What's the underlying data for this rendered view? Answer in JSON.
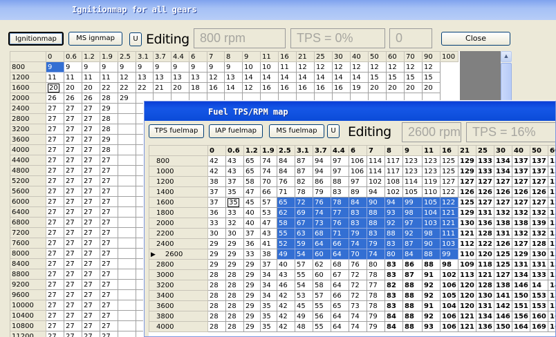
{
  "w1": {
    "title": "Ignitionmap for all gears",
    "btn_ign": "Ignitionmap",
    "btn_ms": "MS ignmap",
    "btn_u": "U",
    "editing": "Editing",
    "rpm": "800 rpm",
    "tps": "TPS =  0%",
    "val": "0",
    "close": "Close",
    "cols": [
      "0",
      "0.6",
      "1.2",
      "1.9",
      "2.5",
      "3.1",
      "3.7",
      "4.4",
      "6",
      "7",
      "8",
      "9",
      "11",
      "16",
      "21",
      "25",
      "30",
      "40",
      "50",
      "60",
      "70",
      "90",
      "100"
    ],
    "rows": [
      [
        "800",
        [
          "9",
          "9",
          "9",
          "9",
          "9",
          "9",
          "9",
          "9",
          "9",
          "9",
          "9",
          "10",
          "10",
          "11",
          "12",
          "12",
          "12",
          "12",
          "12",
          "12",
          "12",
          "12"
        ]
      ],
      [
        "1200",
        [
          "11",
          "11",
          "11",
          "11",
          "12",
          "13",
          "13",
          "13",
          "13",
          "12",
          "13",
          "14",
          "14",
          "14",
          "14",
          "14",
          "14",
          "14",
          "15",
          "15",
          "15",
          "15"
        ]
      ],
      [
        "1600",
        [
          "20",
          "20",
          "20",
          "22",
          "22",
          "22",
          "21",
          "20",
          "18",
          "16",
          "14",
          "12",
          "16",
          "16",
          "16",
          "16",
          "16",
          "19",
          "20",
          "20",
          "20",
          "20"
        ]
      ],
      [
        "2000",
        [
          "26",
          "26",
          "26",
          "28",
          "29",
          "",
          "",
          "",
          "",
          "",
          "",
          "",
          "",
          "",
          "",
          "",
          "",
          "",
          "",
          "",
          "",
          ""
        ]
      ],
      [
        "2400",
        [
          "27",
          "27",
          "27",
          "29",
          "",
          "",
          "",
          "",
          "",
          "",
          "",
          "",
          "",
          "",
          "",
          "",
          "",
          "",
          "",
          "",
          "",
          ""
        ]
      ],
      [
        "2800",
        [
          "27",
          "27",
          "27",
          "28",
          "",
          "",
          "",
          "",
          "",
          "",
          "",
          "",
          "",
          "",
          "",
          "",
          "",
          "",
          "",
          "",
          "",
          ""
        ]
      ],
      [
        "3200",
        [
          "27",
          "27",
          "27",
          "28",
          "",
          "",
          "",
          "",
          "",
          "",
          "",
          "",
          "",
          "",
          "",
          "",
          "",
          "",
          "",
          "",
          "",
          ""
        ]
      ],
      [
        "3600",
        [
          "27",
          "27",
          "27",
          "29",
          "",
          "",
          "",
          "",
          "",
          "",
          "",
          "",
          "",
          "",
          "",
          "",
          "",
          "",
          "",
          "",
          "",
          ""
        ]
      ],
      [
        "4000",
        [
          "27",
          "27",
          "27",
          "28",
          "",
          "",
          "",
          "",
          "",
          "",
          "",
          "",
          "",
          "",
          "",
          "",
          "",
          "",
          "",
          "",
          "",
          ""
        ]
      ],
      [
        "4400",
        [
          "27",
          "27",
          "27",
          "27",
          "",
          "",
          "",
          "",
          "",
          "",
          "",
          "",
          "",
          "",
          "",
          "",
          "",
          "",
          "",
          "",
          "",
          ""
        ]
      ],
      [
        "4800",
        [
          "27",
          "27",
          "27",
          "27",
          "",
          "",
          "",
          "",
          "",
          "",
          "",
          "",
          "",
          "",
          "",
          "",
          "",
          "",
          "",
          "",
          "",
          ""
        ]
      ],
      [
        "5200",
        [
          "27",
          "27",
          "27",
          "27",
          "",
          "",
          "",
          "",
          "",
          "",
          "",
          "",
          "",
          "",
          "",
          "",
          "",
          "",
          "",
          "",
          "",
          ""
        ]
      ],
      [
        "5600",
        [
          "27",
          "27",
          "27",
          "27",
          "",
          "",
          "",
          "",
          "",
          "",
          "",
          "",
          "",
          "",
          "",
          "",
          "",
          "",
          "",
          "",
          "",
          ""
        ]
      ],
      [
        "6000",
        [
          "27",
          "27",
          "27",
          "27",
          "",
          "",
          "",
          "",
          "",
          "",
          "",
          "",
          "",
          "",
          "",
          "",
          "",
          "",
          "",
          "",
          "",
          ""
        ]
      ],
      [
        "6400",
        [
          "27",
          "27",
          "27",
          "27",
          "",
          "",
          "",
          "",
          "",
          "",
          "",
          "",
          "",
          "",
          "",
          "",
          "",
          "",
          "",
          "",
          "",
          ""
        ]
      ],
      [
        "6800",
        [
          "27",
          "27",
          "27",
          "27",
          "",
          "",
          "",
          "",
          "",
          "",
          "",
          "",
          "",
          "",
          "",
          "",
          "",
          "",
          "",
          "",
          "",
          ""
        ]
      ],
      [
        "7200",
        [
          "27",
          "27",
          "27",
          "27",
          "",
          "",
          "",
          "",
          "",
          "",
          "",
          "",
          "",
          "",
          "",
          "",
          "",
          "",
          "",
          "",
          "",
          ""
        ]
      ],
      [
        "7600",
        [
          "27",
          "27",
          "27",
          "27",
          "",
          "",
          "",
          "",
          "",
          "",
          "",
          "",
          "",
          "",
          "",
          "",
          "",
          "",
          "",
          "",
          "",
          ""
        ]
      ],
      [
        "8000",
        [
          "27",
          "27",
          "27",
          "27",
          "",
          "",
          "",
          "",
          "",
          "",
          "",
          "",
          "",
          "",
          "",
          "",
          "",
          "",
          "",
          "",
          "",
          ""
        ]
      ],
      [
        "8400",
        [
          "27",
          "27",
          "27",
          "27",
          "",
          "",
          "",
          "",
          "",
          "",
          "",
          "",
          "",
          "",
          "",
          "",
          "",
          "",
          "",
          "",
          "",
          ""
        ]
      ],
      [
        "8800",
        [
          "27",
          "27",
          "27",
          "27",
          "",
          "",
          "",
          "",
          "",
          "",
          "",
          "",
          "",
          "",
          "",
          "",
          "",
          "",
          "",
          "",
          "",
          ""
        ]
      ],
      [
        "9200",
        [
          "27",
          "27",
          "27",
          "27",
          "",
          "",
          "",
          "",
          "",
          "",
          "",
          "",
          "",
          "",
          "",
          "",
          "",
          "",
          "",
          "",
          "",
          ""
        ]
      ],
      [
        "9600",
        [
          "27",
          "27",
          "27",
          "27",
          "",
          "",
          "",
          "",
          "",
          "",
          "",
          "",
          "",
          "",
          "",
          "",
          "",
          "",
          "",
          "",
          "",
          ""
        ]
      ],
      [
        "10000",
        [
          "27",
          "27",
          "27",
          "27",
          "",
          "",
          "",
          "",
          "",
          "",
          "",
          "",
          "",
          "",
          "",
          "",
          "",
          "",
          "",
          "",
          "",
          ""
        ]
      ],
      [
        "10400",
        [
          "27",
          "27",
          "27",
          "27",
          "",
          "",
          "",
          "",
          "",
          "",
          "",
          "",
          "",
          "",
          "",
          "",
          "",
          "",
          "",
          "",
          "",
          ""
        ]
      ],
      [
        "10800",
        [
          "27",
          "27",
          "27",
          "27",
          "",
          "",
          "",
          "",
          "",
          "",
          "",
          "",
          "",
          "",
          "",
          "",
          "",
          "",
          "",
          "",
          "",
          ""
        ]
      ],
      [
        "11200",
        [
          "27",
          "27",
          "27",
          "27",
          "",
          "",
          "",
          "",
          "",
          "",
          "",
          "",
          "",
          "",
          "",
          "",
          "",
          "",
          "",
          "",
          "",
          ""
        ]
      ]
    ]
  },
  "w2": {
    "title": "Fuel TPS/RPM map",
    "btn_tps": "TPS fuelmap",
    "btn_iap": "IAP fuelmap",
    "btn_ms": "MS fuelmap",
    "btn_u": "U",
    "editing": "Editing",
    "rpm": "2600 rpm",
    "tps": "TPS =  16%",
    "marker": "▶",
    "cols": [
      "0",
      "0.6",
      "1.2",
      "1.9",
      "2.5",
      "3.1",
      "3.7",
      "4.4",
      "6",
      "7",
      "8",
      "9",
      "11",
      "16",
      "21",
      "25",
      "30",
      "40",
      "50",
      "60"
    ],
    "rows": [
      [
        "800",
        [
          "42",
          "43",
          "65",
          "74",
          "84",
          "87",
          "94",
          "97",
          "106",
          "114",
          "117",
          "123",
          "123",
          "125",
          "129",
          "133",
          "134",
          "137",
          "137",
          "13"
        ]
      ],
      [
        "1000",
        [
          "42",
          "43",
          "65",
          "74",
          "84",
          "87",
          "94",
          "97",
          "106",
          "114",
          "117",
          "123",
          "123",
          "125",
          "129",
          "133",
          "134",
          "137",
          "137",
          "13"
        ]
      ],
      [
        "1200",
        [
          "38",
          "37",
          "58",
          "70",
          "76",
          "82",
          "86",
          "88",
          "97",
          "102",
          "108",
          "114",
          "119",
          "127",
          "127",
          "127",
          "127",
          "127",
          "127",
          "12"
        ]
      ],
      [
        "1400",
        [
          "37",
          "35",
          "47",
          "66",
          "71",
          "78",
          "79",
          "83",
          "89",
          "94",
          "102",
          "105",
          "110",
          "122",
          "126",
          "126",
          "126",
          "126",
          "126",
          "12"
        ]
      ],
      [
        "1600",
        [
          "37",
          "35",
          "45",
          "57",
          "65",
          "72",
          "76",
          "78",
          "84",
          "90",
          "94",
          "99",
          "105",
          "122",
          "125",
          "127",
          "127",
          "127",
          "127",
          "12"
        ]
      ],
      [
        "1800",
        [
          "36",
          "33",
          "40",
          "53",
          "62",
          "69",
          "74",
          "77",
          "83",
          "88",
          "93",
          "98",
          "104",
          "121",
          "129",
          "131",
          "132",
          "132",
          "132",
          "13"
        ]
      ],
      [
        "2000",
        [
          "33",
          "32",
          "40",
          "47",
          "58",
          "67",
          "73",
          "76",
          "83",
          "88",
          "92",
          "97",
          "103",
          "121",
          "130",
          "136",
          "138",
          "138",
          "139",
          "13"
        ]
      ],
      [
        "2200",
        [
          "30",
          "30",
          "37",
          "43",
          "55",
          "63",
          "68",
          "71",
          "79",
          "83",
          "88",
          "92",
          "98",
          "111",
          "121",
          "128",
          "131",
          "132",
          "132",
          "13"
        ]
      ],
      [
        "2400",
        [
          "29",
          "29",
          "36",
          "41",
          "52",
          "59",
          "64",
          "66",
          "74",
          "79",
          "83",
          "87",
          "90",
          "103",
          "112",
          "122",
          "126",
          "127",
          "128",
          "12"
        ]
      ],
      [
        "2600",
        [
          "29",
          "29",
          "33",
          "38",
          "49",
          "54",
          "60",
          "64",
          "70",
          "74",
          "80",
          "84",
          "88",
          "99",
          "110",
          "120",
          "125",
          "129",
          "130",
          "13"
        ]
      ],
      [
        "2800",
        [
          "29",
          "29",
          "29",
          "37",
          "40",
          "57",
          "62",
          "68",
          "76",
          "80",
          "83",
          "86",
          "88",
          "98",
          "109",
          "118",
          "125",
          "131",
          "131",
          "13"
        ]
      ],
      [
        "3000",
        [
          "28",
          "28",
          "29",
          "34",
          "43",
          "55",
          "60",
          "67",
          "72",
          "78",
          "83",
          "87",
          "91",
          "102",
          "113",
          "121",
          "127",
          "134",
          "133",
          "13"
        ]
      ],
      [
        "3200",
        [
          "28",
          "28",
          "29",
          "34",
          "46",
          "54",
          "58",
          "64",
          "72",
          "77",
          "82",
          "88",
          "92",
          "106",
          "120",
          "128",
          "138",
          "146",
          "14",
          "14"
        ]
      ],
      [
        "3400",
        [
          "28",
          "28",
          "29",
          "34",
          "42",
          "53",
          "57",
          "66",
          "72",
          "78",
          "83",
          "88",
          "92",
          "105",
          "120",
          "130",
          "141",
          "150",
          "153",
          "15"
        ]
      ],
      [
        "3600",
        [
          "28",
          "28",
          "29",
          "35",
          "42",
          "45",
          "55",
          "65",
          "73",
          "78",
          "83",
          "88",
          "91",
          "104",
          "120",
          "131",
          "142",
          "151",
          "153",
          "15"
        ]
      ],
      [
        "3800",
        [
          "28",
          "28",
          "29",
          "35",
          "42",
          "49",
          "56",
          "64",
          "74",
          "79",
          "84",
          "88",
          "92",
          "106",
          "121",
          "134",
          "146",
          "156",
          "160",
          "16"
        ]
      ],
      [
        "4000",
        [
          "28",
          "28",
          "29",
          "35",
          "42",
          "48",
          "55",
          "64",
          "74",
          "79",
          "84",
          "88",
          "93",
          "106",
          "121",
          "136",
          "150",
          "164",
          "169",
          "16"
        ]
      ]
    ]
  }
}
